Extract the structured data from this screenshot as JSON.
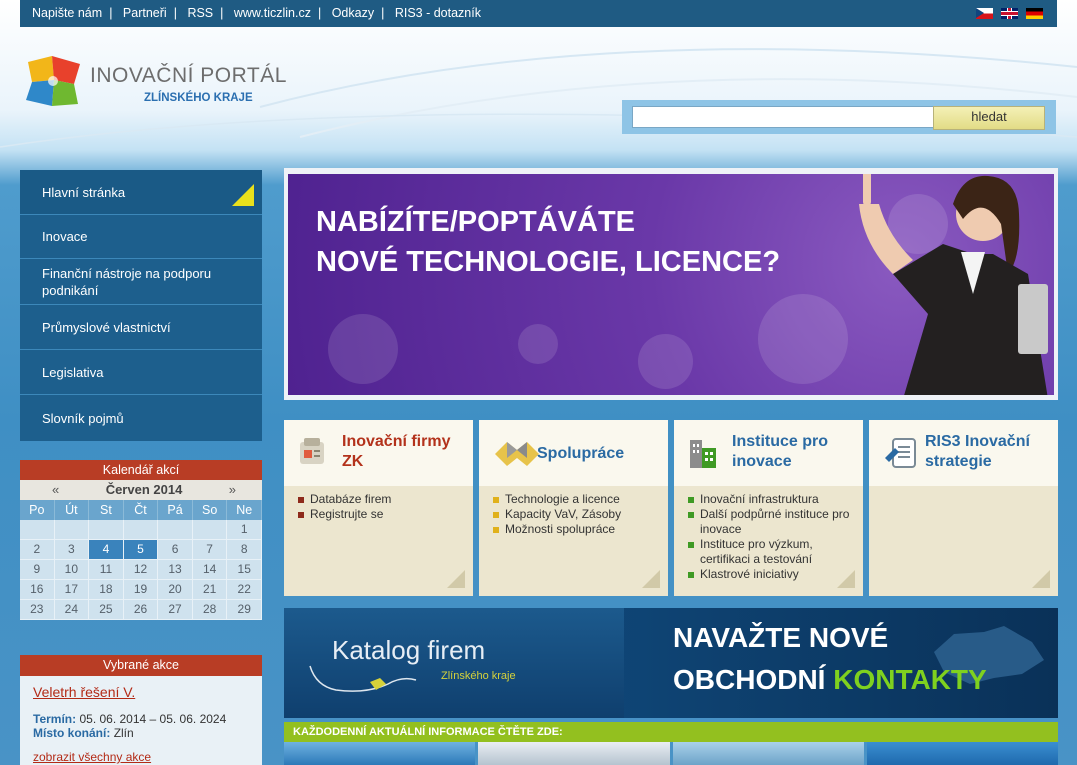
{
  "topbar": {
    "links": [
      "Napište nám",
      "Partneři",
      "RSS",
      "www.ticzlin.cz",
      "Odkazy",
      "RIS3 - dotazník"
    ],
    "flags": [
      "cz-flag-icon",
      "en-flag-icon",
      "de-flag-icon"
    ]
  },
  "logo": {
    "title": "INOVAČNÍ PORTÁL",
    "subtitle": "ZLÍNSKÉHO KRAJE"
  },
  "search": {
    "value": "",
    "button_label": "hledat"
  },
  "sidenav": {
    "items": [
      {
        "label": "Hlavní stránka",
        "active": true
      },
      {
        "label": "Inovace"
      },
      {
        "label": "Finanční nástroje na podporu podnikání"
      },
      {
        "label": "Průmyslové vlastnictví"
      },
      {
        "label": "Legislativa"
      },
      {
        "label": "Slovník pojmů"
      }
    ]
  },
  "calendar": {
    "title": "Kalendář akcí",
    "prev": "«",
    "month": "Červen 2014",
    "next": "»",
    "days_of_week": [
      "Po",
      "Út",
      "St",
      "Čt",
      "Pá",
      "So",
      "Ne"
    ],
    "weeks": [
      [
        "",
        "",
        "",
        "",
        "",
        "",
        "1"
      ],
      [
        "2",
        "3",
        "4",
        "5",
        "6",
        "7",
        "8"
      ],
      [
        "9",
        "10",
        "11",
        "12",
        "13",
        "14",
        "15"
      ],
      [
        "16",
        "17",
        "18",
        "19",
        "20",
        "21",
        "22"
      ],
      [
        "23",
        "24",
        "25",
        "26",
        "27",
        "28",
        "29"
      ]
    ],
    "highlighted": [
      "4",
      "5"
    ]
  },
  "events": {
    "title": "Vybrané akce",
    "link": "Veletrh řešení V.",
    "term_label": "Termín:",
    "term_value": "05. 06. 2014 – 05. 06. 2024",
    "place_label": "Místo konání:",
    "place_value": "Zlín",
    "show_all": "zobrazit všechny akce"
  },
  "banner": {
    "line1": "NABÍZÍTE/POPTÁVÁTE",
    "line2": "NOVÉ TECHNOLOGIE, LICENCE?"
  },
  "cards": [
    {
      "title": "Inovační firmy ZK",
      "icon": "inovacni-firmy-icon",
      "title_color": "#b3321b",
      "bullet_color": "#8e2a1b",
      "items": [
        "Databáze firem",
        "Registrujte se"
      ]
    },
    {
      "title": "Spolupráce",
      "icon": "handshake-icon",
      "title_color": "#2a6aa3",
      "bullet_color": "#e0b11b",
      "items": [
        "Technologie a licence",
        "Kapacity VaV, Zásoby",
        "Možnosti spolupráce"
      ]
    },
    {
      "title": "Instituce pro inovace",
      "icon": "building-icon",
      "title_color": "#2a6aa3",
      "bullet_color": "#3f9a24",
      "items": [
        "Inovační infrastruktura",
        "Další podpůrné instituce pro inovace",
        "Instituce pro výzkum, certifikaci a testování",
        "Klastrové iniciativy"
      ]
    },
    {
      "title": "RIS3 Inovační strategie",
      "icon": "document-pen-icon",
      "title_color": "#2a6aa3",
      "bullet_color": "#2a6aa3",
      "items": []
    }
  ],
  "katalog": {
    "title": "Katalog firem",
    "subtitle": "Zlínského kraje",
    "right_line1": "NAVAŽTE NOVÉ",
    "right_line2_a": "OBCHODNÍ ",
    "right_line2_b": "KONTAKTY"
  },
  "daily": {
    "text": "KAŽDODENNÍ AKTUÁLNÍ INFORMACE ČTĚTE ZDE:"
  }
}
